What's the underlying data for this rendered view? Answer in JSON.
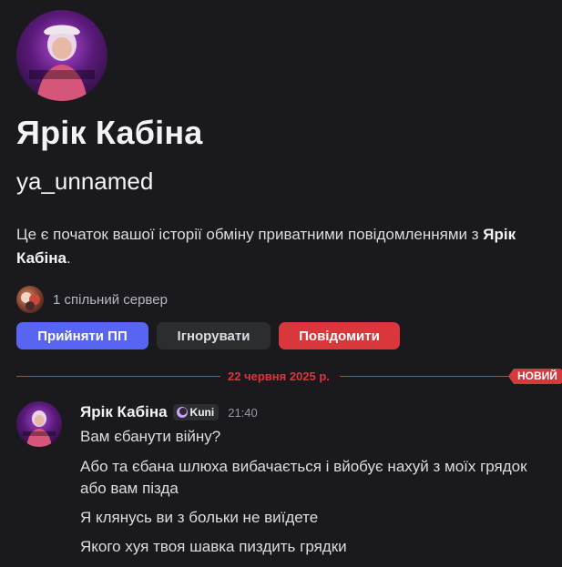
{
  "profile": {
    "display_name": "Ярік Кабіна",
    "username": "ya_unnamed",
    "avatar_text": "ЯRI_UNNAMED",
    "intro_prefix": "Це є початок вашої історії обміну приватними повідомленнями з ",
    "intro_name": "Ярік Кабіна",
    "intro_suffix": "."
  },
  "mutual": {
    "text": "1 спільний сервер"
  },
  "actions": {
    "accept_label": "Прийняти ПП",
    "ignore_label": "Ігнорувати",
    "report_label": "Повідомити"
  },
  "divider": {
    "date": "22 червня 2025 р.",
    "new_label": "НОВИЙ"
  },
  "message": {
    "author": "Ярік Кабіна",
    "tag": "Kuni",
    "time": "21:40",
    "lines": [
      "Вам єбанути війну?",
      "Або та єбана шлюха вибачається і вйобує нахуй з моїх грядок або вам пізда",
      "Я клянусь ви з больки не виїдете",
      "Якого хуя твоя шавка пиздить грядки"
    ]
  },
  "colors": {
    "background": "#1a1a1e",
    "accent_blurple": "#5865f2",
    "danger_red": "#da373c",
    "secondary_button": "#2b2d31"
  }
}
